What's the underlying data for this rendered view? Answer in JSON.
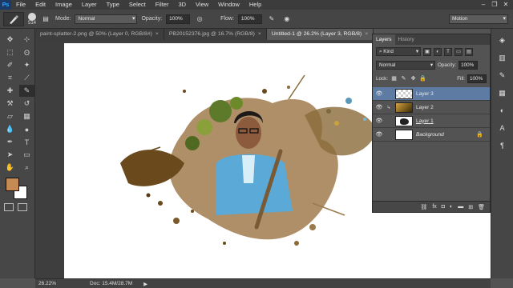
{
  "app": {
    "logo": "Ps"
  },
  "menu": [
    "File",
    "Edit",
    "Image",
    "Layer",
    "Type",
    "Select",
    "Filter",
    "3D",
    "View",
    "Window",
    "Help"
  ],
  "window_controls": [
    "–",
    "❐",
    "✕"
  ],
  "options": {
    "brush_size": "514",
    "mode_label": "Mode:",
    "mode_value": "Normal",
    "opacity_label": "Opacity:",
    "opacity_value": "100%",
    "flow_label": "Flow:",
    "flow_value": "100%",
    "workspace": "Motion"
  },
  "tabs": [
    {
      "label": "paint-splatter-2.png @ 50% (Layer 0, RGB/8#)",
      "active": false
    },
    {
      "label": "PB20152376.jpg @ 16.7% (RGB/8)",
      "active": false
    },
    {
      "label": "Untitled-1 @ 26.2% (Layer 3, RGB/8)",
      "active": true
    }
  ],
  "layers_panel": {
    "tab_layers": "Layers",
    "tab_history": "History",
    "kind_label": "Kind",
    "blend_mode": "Normal",
    "opacity_label": "Opacity:",
    "opacity_value": "100%",
    "lock_label": "Lock:",
    "fill_label": "Fill:",
    "fill_value": "100%",
    "layers": [
      {
        "name": "Layer 3",
        "thumb": "checker",
        "selected": true,
        "linked": false,
        "italic": false
      },
      {
        "name": "Layer 2",
        "thumb": "photo",
        "selected": false,
        "linked": true,
        "italic": false
      },
      {
        "name": "Layer 1",
        "thumb": "mask",
        "selected": false,
        "linked": false,
        "italic": false
      },
      {
        "name": "Background",
        "thumb": "white",
        "selected": false,
        "linked": false,
        "italic": true
      }
    ],
    "bottom_icons": [
      "link-icon",
      "fx-icon",
      "mask-icon",
      "adjustment-icon",
      "folder-icon",
      "new-layer-icon",
      "trash-icon"
    ]
  },
  "status": {
    "zoom": "26.22%",
    "doc": "Doc: 15.4M/28.7M"
  },
  "colors": {
    "foreground": "#c68a55",
    "background": "#ffffff",
    "selected_layer": "#5d7ba3"
  }
}
